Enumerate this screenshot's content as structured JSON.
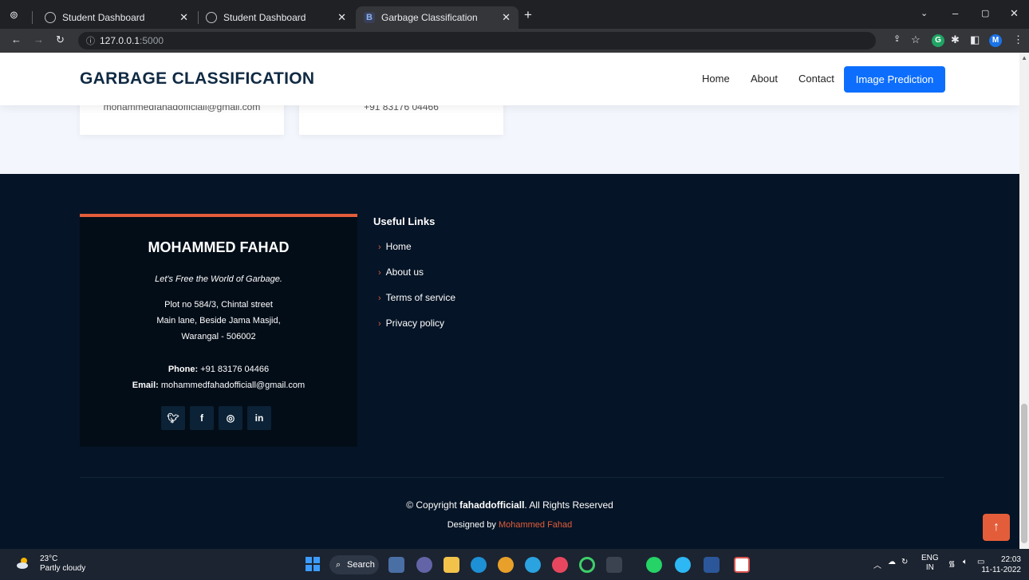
{
  "browser": {
    "tabs": [
      {
        "title": "Student Dashboard"
      },
      {
        "title": "Student Dashboard"
      },
      {
        "title": "Garbage Classification",
        "favicon_letter": "B"
      }
    ],
    "url_host": "127.0.0.1",
    "url_port": ":5000",
    "profile_initial": "M"
  },
  "site": {
    "logo": "GARBAGE CLASSIFICATION",
    "nav": [
      "Home",
      "About",
      "Contact"
    ],
    "cta": "Image Prediction",
    "contact_cards": [
      "mohammedfahadofficiall@gmail.com",
      "+91 83176 04466"
    ]
  },
  "footer": {
    "name": "MOHAMMED FAHAD",
    "tagline": "Let's Free the World of Garbage.",
    "address": [
      "Plot no 584/3, Chintal street",
      "Main lane, Beside Jama Masjid,",
      "Warangal - 506002"
    ],
    "phone_label": "Phone:",
    "phone": "+91 83176 04466",
    "email_label": "Email:",
    "email": "mohammedfahadofficiall@gmail.com",
    "social": [
      "twitter-icon",
      "facebook-icon",
      "instagram-icon",
      "linkedin-icon"
    ],
    "links_title": "Useful Links",
    "links": [
      "Home",
      "About us",
      "Terms of service",
      "Privacy policy"
    ],
    "copyright_prefix": "© Copyright",
    "copyright_owner": "fahaddofficiall",
    "copyright_suffix": ". All Rights Reserved",
    "designed_prefix": "Designed by",
    "designed_author": "Mohammed Fahad"
  },
  "taskbar": {
    "temperature": "23°C",
    "weather": "Partly cloudy",
    "search": "Search",
    "lang": "ENG",
    "region": "IN",
    "time": "22:03",
    "date": "11-11-2022"
  },
  "colors": {
    "accent": "#e35d3a",
    "primary": "#0d6efd",
    "footer_bg": "#051426"
  }
}
